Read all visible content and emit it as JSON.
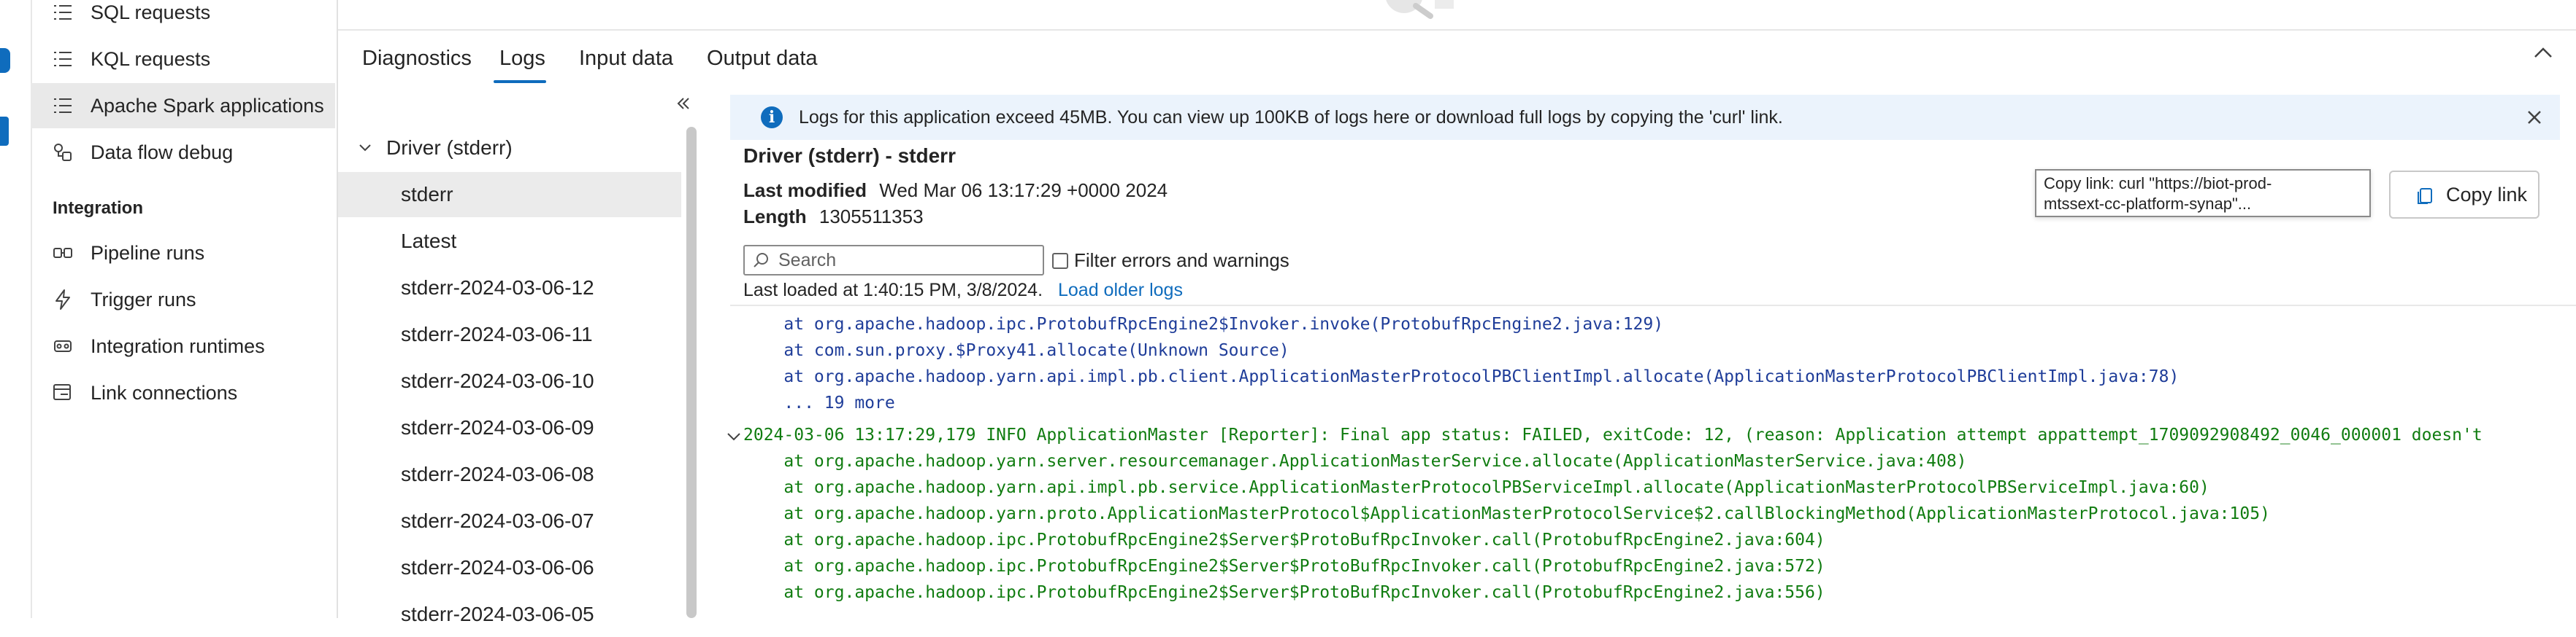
{
  "nav": {
    "items": [
      {
        "label": "SQL requests",
        "icon": "list-icon"
      },
      {
        "label": "KQL requests",
        "icon": "list-icon"
      },
      {
        "label": "Apache Spark applications",
        "icon": "list-icon",
        "active": true
      },
      {
        "label": "Data flow debug",
        "icon": "dataflow-icon"
      }
    ],
    "section_integration": "Integration",
    "integration_items": [
      {
        "label": "Pipeline runs",
        "icon": "pipeline-icon"
      },
      {
        "label": "Trigger runs",
        "icon": "lightning-icon"
      },
      {
        "label": "Integration runtimes",
        "icon": "runtime-icon"
      },
      {
        "label": "Link connections",
        "icon": "link-connection-icon"
      }
    ]
  },
  "tabs": [
    {
      "label": "Diagnostics"
    },
    {
      "label": "Logs",
      "selected": true
    },
    {
      "label": "Input data"
    },
    {
      "label": "Output data"
    }
  ],
  "tree": {
    "group_label": "Driver (stderr)",
    "items": [
      {
        "label": "stderr",
        "selected": true
      },
      {
        "label": "Latest"
      },
      {
        "label": "stderr-2024-03-06-12"
      },
      {
        "label": "stderr-2024-03-06-11"
      },
      {
        "label": "stderr-2024-03-06-10"
      },
      {
        "label": "stderr-2024-03-06-09"
      },
      {
        "label": "stderr-2024-03-06-08"
      },
      {
        "label": "stderr-2024-03-06-07"
      },
      {
        "label": "stderr-2024-03-06-06"
      },
      {
        "label": "stderr-2024-03-06-05"
      }
    ]
  },
  "banner": {
    "text": "Logs for this application exceed 45MB. You can view up 100KB of logs here or download full logs by copying the 'curl' link."
  },
  "detail": {
    "title": "Driver (stderr) - stderr",
    "last_modified_label": "Last modified",
    "last_modified_value": "Wed Mar 06 13:17:29 +0000 2024",
    "length_label": "Length",
    "length_value": "1305511353",
    "tooltip_line1": "Copy link: curl \"https://biot-prod-",
    "tooltip_line2": "mtssext-cc-platform-synap\"...",
    "copy_label": "Copy link",
    "search_placeholder": "Search",
    "filter_label": "Filter errors and warnings",
    "loaded_text": "Last loaded at 1:40:15 PM, 3/8/2024.",
    "load_older": "Load older logs"
  },
  "log": {
    "lines": [
      {
        "text": "    at org.apache.hadoop.ipc.ProtobufRpcEngine2$Invoker.invoke(ProtobufRpcEngine2.java:129)",
        "color": "blue"
      },
      {
        "text": "    at com.sun.proxy.$Proxy41.allocate(Unknown Source)",
        "color": "blue"
      },
      {
        "text": "    at org.apache.hadoop.yarn.api.impl.pb.client.ApplicationMasterProtocolPBClientImpl.allocate(ApplicationMasterProtocolPBClientImpl.java:78)",
        "color": "blue"
      },
      {
        "text": "    ... 19 more",
        "color": "blue"
      },
      {
        "text": "2024-03-06 13:17:29,179 INFO ApplicationMaster [Reporter]: Final app status: FAILED, exitCode: 12, (reason: Application attempt appattempt_1709092908492_0046_000001 doesn't",
        "color": "green"
      },
      {
        "text": "    at org.apache.hadoop.yarn.server.resourcemanager.ApplicationMasterService.allocate(ApplicationMasterService.java:408)",
        "color": "green"
      },
      {
        "text": "    at org.apache.hadoop.yarn.api.impl.pb.service.ApplicationMasterProtocolPBServiceImpl.allocate(ApplicationMasterProtocolPBServiceImpl.java:60)",
        "color": "green"
      },
      {
        "text": "    at org.apache.hadoop.yarn.proto.ApplicationMasterProtocol$ApplicationMasterProtocolService$2.callBlockingMethod(ApplicationMasterProtocol.java:105)",
        "color": "green"
      },
      {
        "text": "    at org.apache.hadoop.ipc.ProtobufRpcEngine2$Server$ProtoBufRpcInvoker.call(ProtobufRpcEngine2.java:604)",
        "color": "green"
      },
      {
        "text": "    at org.apache.hadoop.ipc.ProtobufRpcEngine2$Server$ProtoBufRpcInvoker.call(ProtobufRpcEngine2.java:572)",
        "color": "green"
      },
      {
        "text": "    at org.apache.hadoop.ipc.ProtobufRpcEngine2$Server$ProtoBufRpcInvoker.call(ProtobufRpcEngine2.java:556)",
        "color": "green"
      }
    ]
  },
  "colors": {
    "accent": "#0f6cbd",
    "log_blue": "#1f3d99",
    "log_green": "#107c10",
    "banner_bg": "#ebf3fc",
    "selected_bg": "#ebebeb"
  }
}
